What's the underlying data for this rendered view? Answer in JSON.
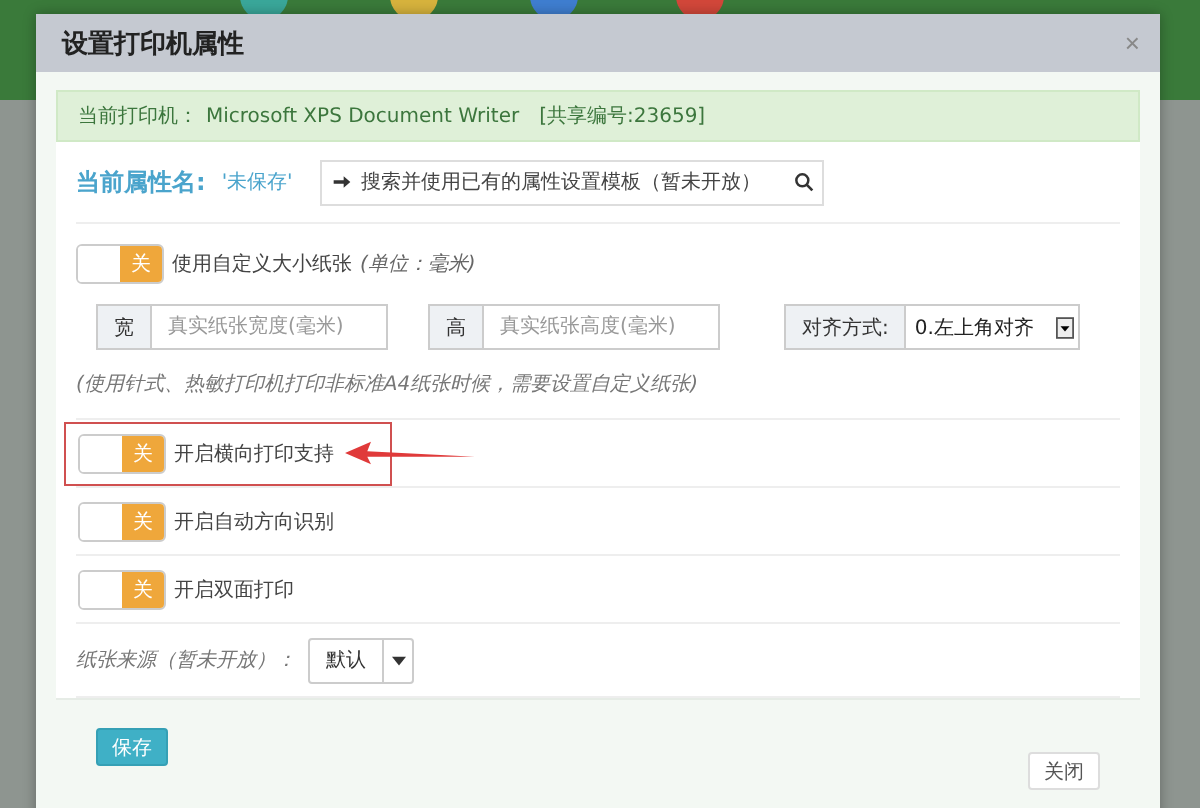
{
  "dialog": {
    "title": "设置打印机属性",
    "close_icon": "×"
  },
  "printer_info": {
    "label": "当前打印机：",
    "name": "Microsoft XPS Document Writer",
    "share": "[共享编号:23659]"
  },
  "profile": {
    "label": "当前属性名:",
    "value": "'未保存'",
    "search_placeholder": "搜索并使用已有的属性设置模板（暂未开放）"
  },
  "custom_paper": {
    "toggle": {
      "on": false,
      "off_text": "关"
    },
    "label": "使用自定义大小纸张",
    "unit": "(单位：毫米)",
    "width": {
      "addon": "宽",
      "placeholder": "真实纸张宽度(毫米)"
    },
    "height": {
      "addon": "高",
      "placeholder": "真实纸张高度(毫米)"
    },
    "align": {
      "addon": "对齐方式:",
      "value": "0.左上角对齐"
    },
    "hint": "(使用针式、热敏打印机打印非标准A4纸张时候，需要设置自定义纸张)"
  },
  "options": [
    {
      "label": "开启横向打印支持",
      "on": false,
      "off_text": "关",
      "highlighted": true
    },
    {
      "label": "开启自动方向识别",
      "on": false,
      "off_text": "关",
      "highlighted": false
    },
    {
      "label": "开启双面打印",
      "on": false,
      "off_text": "关",
      "highlighted": false
    }
  ],
  "paper_source": {
    "label": "纸张来源（暂未开放）：",
    "value": "默认"
  },
  "buttons": [
    {
      "kind": "primary",
      "label": "保存"
    },
    {
      "kind": "default",
      "label": "关闭"
    }
  ]
}
